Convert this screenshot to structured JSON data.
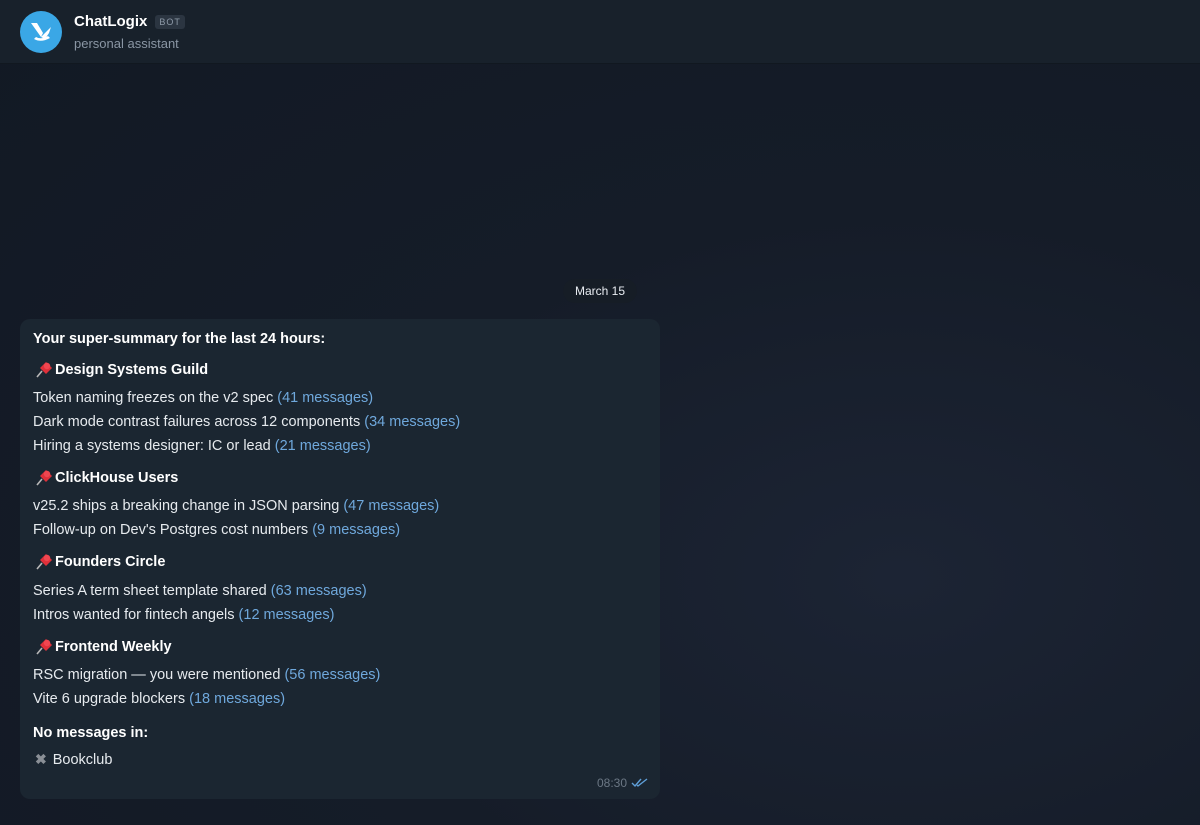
{
  "header": {
    "title": "ChatLogix",
    "badge": "BOT",
    "subtitle": "personal assistant"
  },
  "date_separator": "March 15",
  "message": {
    "heading": "Your super-summary for the last 24 hours:",
    "groups": [
      {
        "title": "Design Systems Guild",
        "items": [
          {
            "text": "Token naming freezes on the v2 spec",
            "count": "(41 messages)"
          },
          {
            "text": "Dark mode contrast failures across 12 components",
            "count": "(34 messages)"
          },
          {
            "text": "Hiring a systems designer: IC or lead",
            "count": "(21 messages)"
          }
        ]
      },
      {
        "title": "ClickHouse Users",
        "items": [
          {
            "text": "v25.2 ships a breaking change in JSON parsing",
            "count": "(47 messages)"
          },
          {
            "text": "Follow-up on Dev's Postgres cost numbers",
            "count": "(9 messages)"
          }
        ]
      },
      {
        "title": "Founders Circle",
        "items": [
          {
            "text": "Series A term sheet template shared",
            "count": "(63 messages)"
          },
          {
            "text": "Intros wanted for fintech angels",
            "count": "(12 messages)"
          }
        ]
      },
      {
        "title": "Frontend Weekly",
        "items": [
          {
            "text": "RSC migration — you were mentioned",
            "count": "(56 messages)"
          },
          {
            "text": "Vite 6 upgrade blockers",
            "count": "(18 messages)"
          }
        ]
      }
    ],
    "no_messages_label": "No messages in:",
    "no_messages_chats": [
      "Bookclub"
    ],
    "time": "08:30",
    "read_status_icon": "double-check-icon"
  },
  "colors": {
    "accent": "#6fa8dc",
    "avatar": "#3aa7e6",
    "bubble": "#1b2631",
    "header": "#18212b"
  }
}
